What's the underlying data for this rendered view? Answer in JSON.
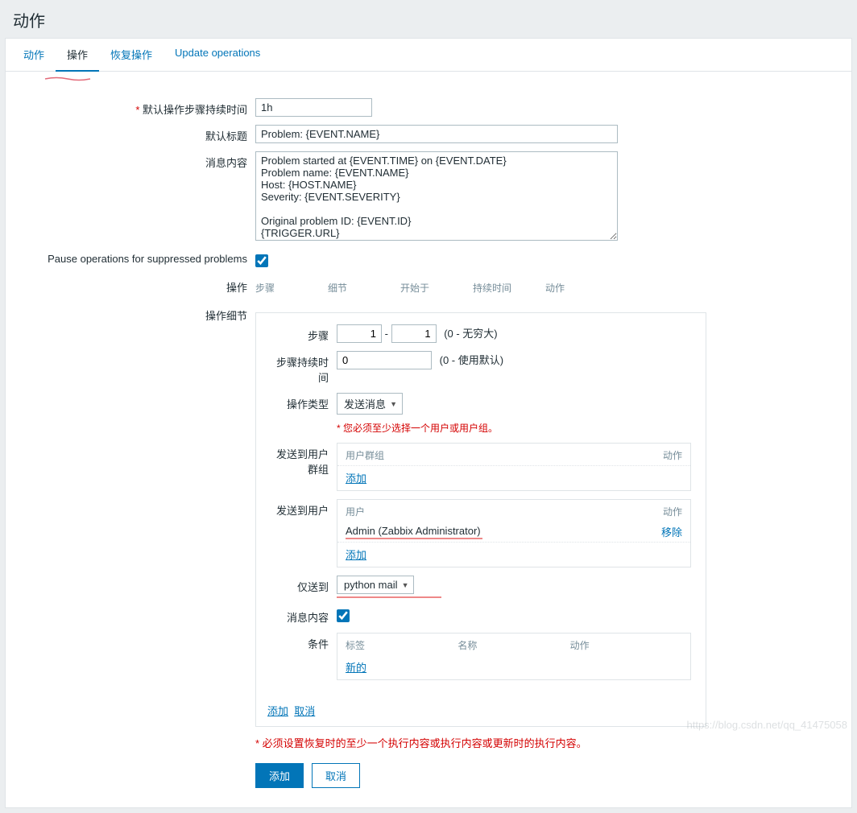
{
  "page_title": "动作",
  "tabs": {
    "action": "动作",
    "operations": "操作",
    "recovery": "恢复操作",
    "update": "Update operations"
  },
  "labels": {
    "default_step_duration": "默认操作步骤持续时间",
    "default_subject": "默认标题",
    "message": "消息内容",
    "pause_suppressed": "Pause operations for suppressed problems",
    "operations": "操作",
    "operation_detail": "操作细节"
  },
  "fields": {
    "step_duration": "1h",
    "subject": "Problem: {EVENT.NAME}",
    "message": "Problem started at {EVENT.TIME} on {EVENT.DATE}\nProblem name: {EVENT.NAME}\nHost: {HOST.NAME}\nSeverity: {EVENT.SEVERITY}\n\nOriginal problem ID: {EVENT.ID}\n{TRIGGER.URL}",
    "pause_checked": true
  },
  "ops_table_cols": {
    "step": "步骤",
    "detail": "细节",
    "start": "开始于",
    "duration": "持续时间",
    "action": "动作"
  },
  "detail": {
    "labels": {
      "step": "步骤",
      "step_duration": "步骤持续时间",
      "op_type": "操作类型",
      "send_to_groups": "发送到用户群组",
      "send_to_users": "发送到用户",
      "only_send_to": "仅送到",
      "message_content": "消息内容",
      "conditions": "条件"
    },
    "step_from": "1",
    "step_to": "1",
    "step_infinity": "(0 - 无穷大)",
    "step_dur_value": "0",
    "step_dur_hint": "(0 - 使用默认)",
    "op_type_value": "发送消息",
    "err_need_user": "您必须至少选择一个用户或用户组。",
    "groups_table": {
      "col1": "用户群组",
      "col2": "动作",
      "add": "添加"
    },
    "users_table": {
      "col1": "用户",
      "col2": "动作",
      "row1_name": "Admin (Zabbix Administrator)",
      "row1_action": "移除",
      "add": "添加"
    },
    "only_send_value": "python mail",
    "msg_checked": true,
    "cond_table": {
      "col1": "标签",
      "col2": "名称",
      "col3": "动作",
      "add": "新的"
    },
    "foot_add": "添加",
    "foot_cancel": "取消"
  },
  "bottom": {
    "err": "必须设置恢复时的至少一个执行内容或执行内容或更新时的执行内容。",
    "add": "添加",
    "cancel": "取消"
  },
  "watermark": "https://blog.csdn.net/qq_41475058"
}
